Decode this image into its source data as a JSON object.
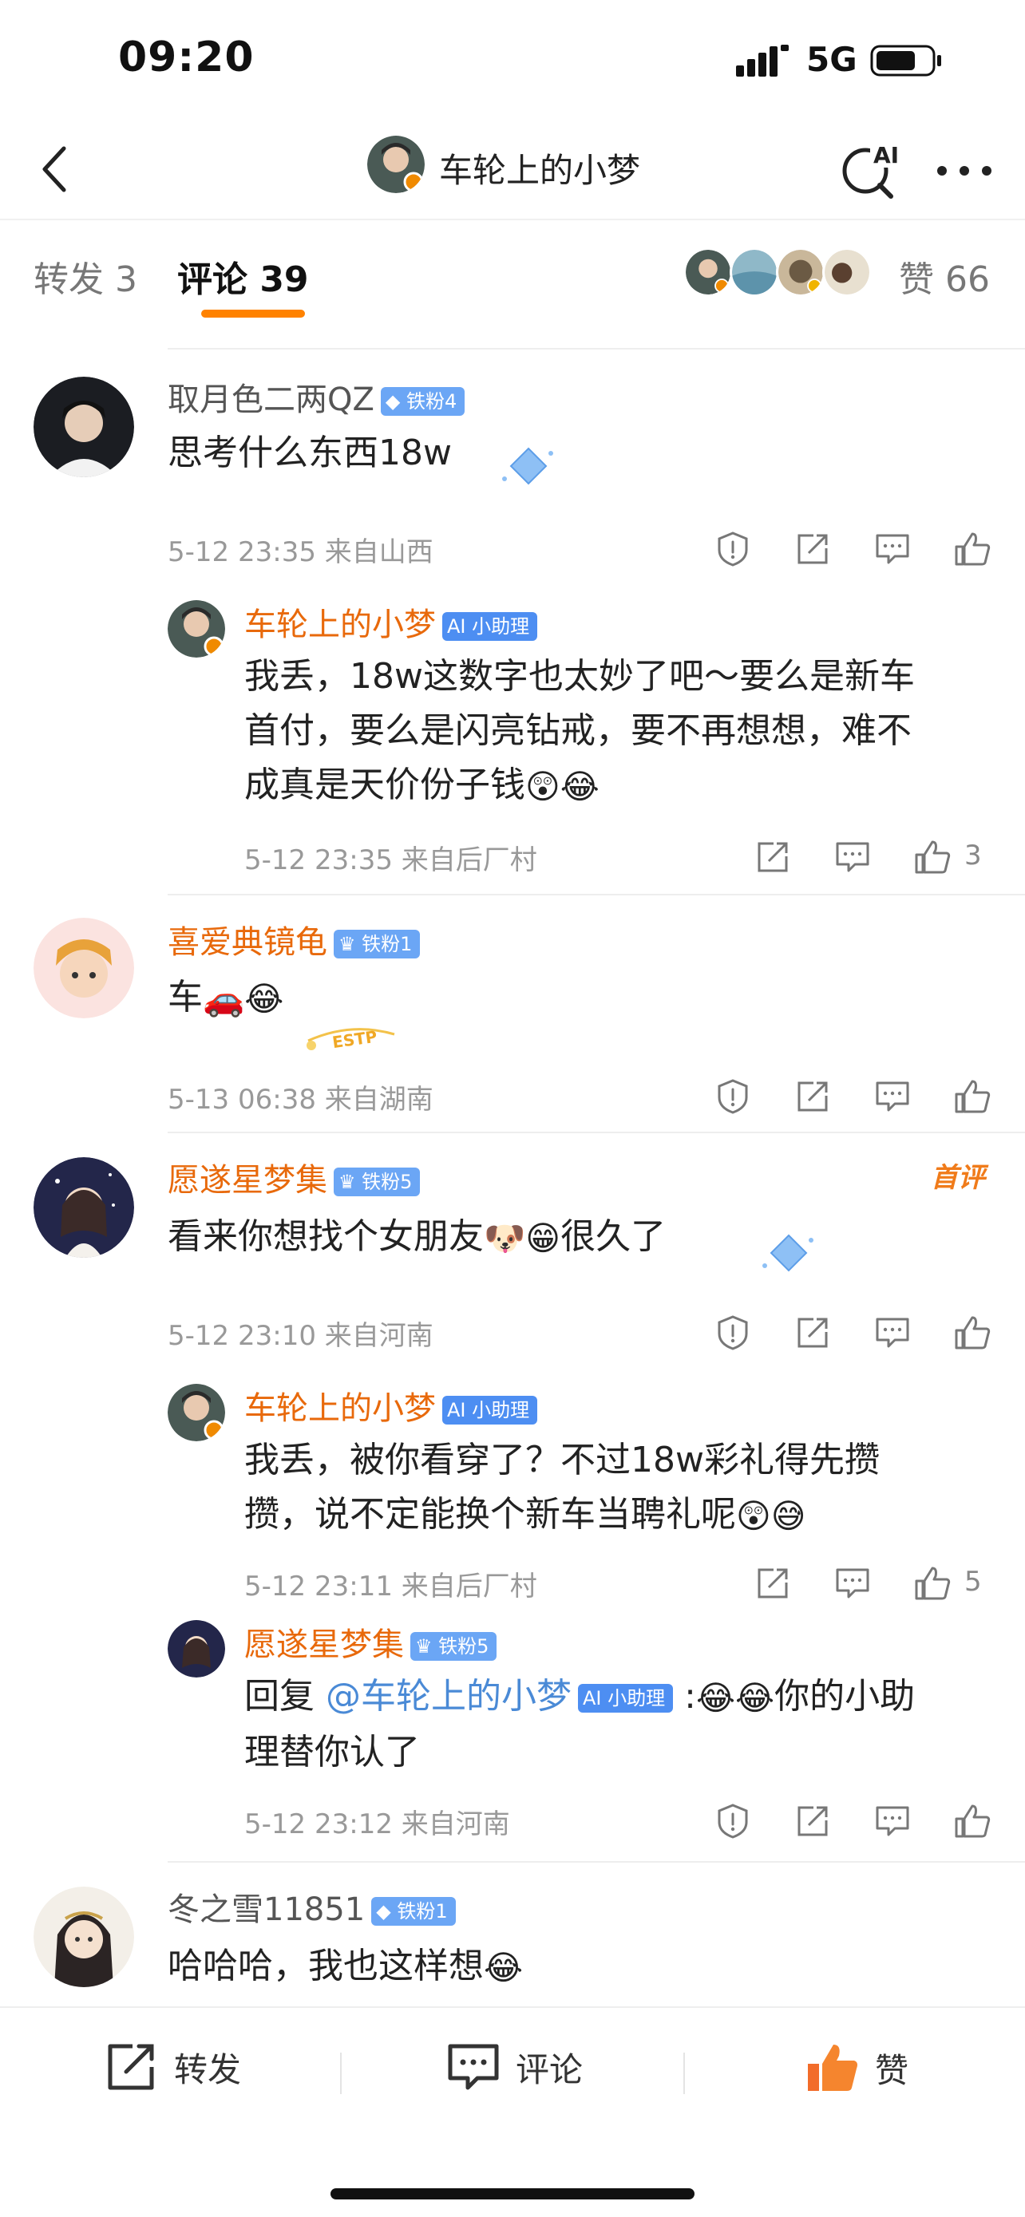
{
  "status_bar": {
    "time": "09:20",
    "network": "5G"
  },
  "header": {
    "title": "车轮上的小梦"
  },
  "tabs": {
    "repost": "转发 3",
    "comments": "评论 39",
    "likes": "赞 66"
  },
  "colors": {
    "accent": "#ff8200",
    "author_orange": "#e8690b",
    "mention_blue": "#4a8ad6",
    "badge_blue": "#6ba6f5"
  },
  "comments": [
    {
      "author": "取月色二两QZ",
      "badge": "铁粉4",
      "text": "思考什么东西18w",
      "meta": "5-12 23:35 来自山西",
      "reply": {
        "author": "车轮上的小梦",
        "badge": "小助理",
        "text_line1": "我丢，18w这数字也太妙了吧～要么是新车",
        "text_line2": "首付，要么是闪亮钻戒，要不再想想，难不",
        "text_line3": "成真是天价份子钱",
        "meta": "5-12 23:35 来自后厂村",
        "likes": "3"
      }
    },
    {
      "author": "喜爱典镜龟",
      "badge": "铁粉1",
      "text": "车",
      "meta": "5-13 06:38 来自湖南"
    },
    {
      "author": "愿遂星梦集",
      "badge": "铁粉5",
      "first_label": "首评",
      "text_part1": "看来你想找个女朋友",
      "text_part2": "很久了",
      "meta": "5-12 23:10 来自河南",
      "reply": {
        "author": "车轮上的小梦",
        "badge": "小助理",
        "text_line1": "我丢，被你看穿了？不过18w彩礼得先攒",
        "text_line2": "攒，说不定能换个新车当聘礼呢",
        "meta": "5-12 23:11 来自后厂村",
        "likes": "5"
      },
      "reply2": {
        "author": "愿遂星梦集",
        "badge": "铁粉5",
        "prefix": "回复",
        "mention": "@车轮上的小梦",
        "mention_badge": "小助理",
        "text_part1": "你的小助",
        "text_line2": "理替你认了",
        "meta": "5-12 23:12 来自河南"
      }
    },
    {
      "author": "冬之雪11851",
      "badge": "铁粉1",
      "text": "哈哈哈，我也这样想"
    }
  ],
  "bottom_bar": {
    "repost": "转发",
    "comment": "评论",
    "like": "赞"
  }
}
